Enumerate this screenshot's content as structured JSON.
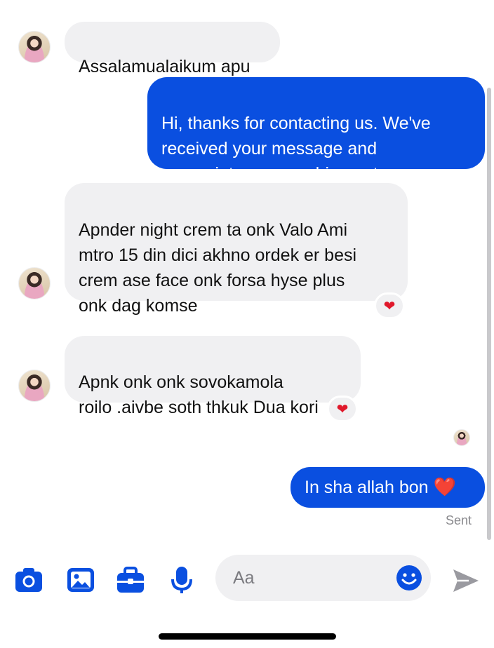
{
  "messages": [
    {
      "side": "in",
      "text": "Assalamualaikum apu"
    },
    {
      "side": "out",
      "text": "Hi, thanks for contacting us. We've\nreceived your message and\nappreciate you reaching out."
    },
    {
      "side": "in",
      "text": "Apnder night crem ta onk Valo Ami\nmtro 15 din dici akhno ordek er besi\ncrem ase face onk forsa hyse plus\nonk dag komse",
      "reaction": "❤"
    },
    {
      "side": "in",
      "text": "Apnk onk onk sovokamola\nroilo .aivbe soth thkuk Dua kori",
      "reaction": "❤"
    },
    {
      "side": "out",
      "text": "In sha allah bon ",
      "emoji": "❤️"
    }
  ],
  "status": {
    "sent": "Sent"
  },
  "composer": {
    "placeholder": "Aa"
  },
  "toolbar": {
    "icons": [
      "camera-icon",
      "photo-icon",
      "briefcase-icon",
      "microphone-icon",
      "emoji-icon",
      "send-icon"
    ]
  },
  "colors": {
    "accent": "#0a4fe0",
    "incoming_bubble": "#f0f0f2",
    "heart": "#e0182b",
    "send_icon": "#9a9aa0"
  }
}
